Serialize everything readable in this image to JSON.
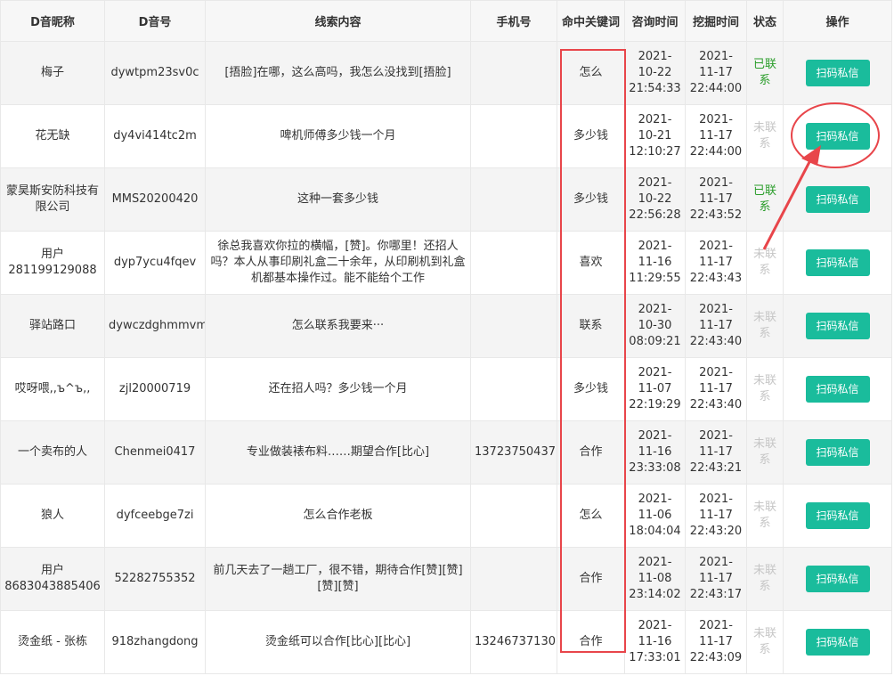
{
  "columns": [
    "D音昵称",
    "D音号",
    "线索内容",
    "手机号",
    "命中关键词",
    "咨询时间",
    "挖掘时间",
    "状态",
    "操作"
  ],
  "status_labels": {
    "contacted": "已联系",
    "not_contacted": "未联系"
  },
  "action_label": "扫码私信",
  "colors": {
    "accent": "#1abc9c",
    "highlight": "#e8454a",
    "contacted": "#2a9d2a",
    "not_contacted": "#c6c6c6"
  },
  "rows": [
    {
      "nickname": "梅子",
      "account": "dywtpm23sv0c",
      "content": "[捂脸]在哪，这么高吗，我怎么没找到[捂脸]",
      "phone": "",
      "keyword": "怎么",
      "consult": [
        "2021-",
        "10-22",
        "21:54:33"
      ],
      "mined": [
        "2021-",
        "11-17",
        "22:44:00"
      ],
      "status": "已联系",
      "status_type": "yes"
    },
    {
      "nickname": "花无缺",
      "account": "dy4vi414tc2m",
      "content": "啤机师傅多少钱一个月",
      "phone": "",
      "keyword": "多少钱",
      "consult": [
        "2021-",
        "10-21",
        "12:10:27"
      ],
      "mined": [
        "2021-",
        "11-17",
        "22:44:00"
      ],
      "status": "未联系",
      "status_type": "no"
    },
    {
      "nickname": "蒙昊斯安防科技有限公司",
      "account": "MMS20200420",
      "content": "这种一套多少钱",
      "phone": "",
      "keyword": "多少钱",
      "consult": [
        "2021-",
        "10-22",
        "22:56:28"
      ],
      "mined": [
        "2021-",
        "11-17",
        "22:43:52"
      ],
      "status": "已联系",
      "status_type": "yes"
    },
    {
      "nickname": "用户281199129088",
      "account": "dyp7ycu4fqev",
      "content": "徐总我喜欢你拉的横幅，[赞]。你哪里！还招人吗？本人从事印刷礼盒二十余年，从印刷机到礼盒机都基本操作过。能不能给个工作",
      "phone": "",
      "keyword": "喜欢",
      "consult": [
        "2021-",
        "11-16",
        "11:29:55"
      ],
      "mined": [
        "2021-",
        "11-17",
        "22:43:43"
      ],
      "status": "未联系",
      "status_type": "no"
    },
    {
      "nickname": "驿站路口",
      "account": "dywczdghmmvm",
      "content": "怎么联系我要来···",
      "phone": "",
      "keyword": "联系",
      "consult": [
        "2021-",
        "10-30",
        "08:09:21"
      ],
      "mined": [
        "2021-",
        "11-17",
        "22:43:40"
      ],
      "status": "未联系",
      "status_type": "no"
    },
    {
      "nickname": "哎呀喂,,ъ^ъ,,",
      "account": "zjl20000719",
      "content": "还在招人吗？多少钱一个月",
      "phone": "",
      "keyword": "多少钱",
      "consult": [
        "2021-",
        "11-07",
        "22:19:29"
      ],
      "mined": [
        "2021-",
        "11-17",
        "22:43:40"
      ],
      "status": "未联系",
      "status_type": "no"
    },
    {
      "nickname": "一个卖布的人",
      "account": "Chenmei0417",
      "content": "专业做装裱布料……期望合作[比心]",
      "phone": "13723750437",
      "keyword": "合作",
      "consult": [
        "2021-",
        "11-16",
        "23:33:08"
      ],
      "mined": [
        "2021-",
        "11-17",
        "22:43:21"
      ],
      "status": "未联系",
      "status_type": "no"
    },
    {
      "nickname": "狼人",
      "account": "dyfceebge7zi",
      "content": "怎么合作老板",
      "phone": "",
      "keyword": "怎么",
      "consult": [
        "2021-",
        "11-06",
        "18:04:04"
      ],
      "mined": [
        "2021-",
        "11-17",
        "22:43:20"
      ],
      "status": "未联系",
      "status_type": "no"
    },
    {
      "nickname": "用户8683043885406",
      "account": "52282755352",
      "content": "前几天去了一趟工厂，很不错，期待合作[赞][赞][赞][赞]",
      "phone": "",
      "keyword": "合作",
      "consult": [
        "2021-",
        "11-08",
        "23:14:02"
      ],
      "mined": [
        "2021-",
        "11-17",
        "22:43:17"
      ],
      "status": "未联系",
      "status_type": "no"
    },
    {
      "nickname": "烫金纸 - 张栋",
      "account": "918zhangdong",
      "content": "烫金纸可以合作[比心][比心]",
      "phone": "13246737130",
      "keyword": "合作",
      "consult": [
        "2021-",
        "11-16",
        "17:33:01"
      ],
      "mined": [
        "2021-",
        "11-17",
        "22:43:09"
      ],
      "status": "未联系",
      "status_type": "no"
    }
  ]
}
